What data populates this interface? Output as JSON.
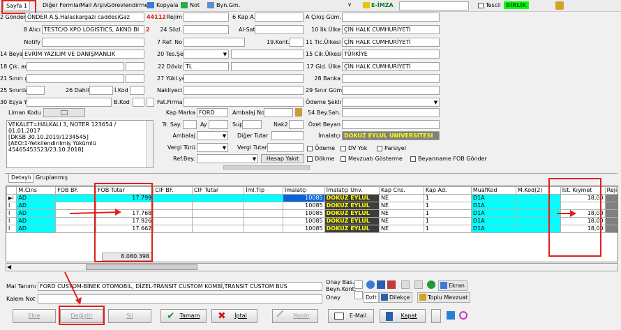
{
  "toolbar": {
    "sayfa": "Sayfa 1",
    "diger": "Diğer Formlar",
    "mail": "Mail Arşiv",
    "gorev": "Görevlendirme",
    "kopyala": "Kopyala",
    "not": "Not",
    "byn": "Byn.Gm.",
    "eimza": "E-İMZA",
    "tescil": "Tescil",
    "birlik": "BİRLİK"
  },
  "left": {
    "gonderen_lbl": "2 Gönderen",
    "gonderen_val": "ÖNDER A.Ş.Halaskargazi caddesiGaz",
    "gonderen_code": "44112",
    "alici_lbl": "8 Alıcı",
    "alici_val": "TESTC/O XPO LOGISTICS, AKNO BI",
    "alici_code": "2",
    "notify_lbl": "Notify",
    "beyan_lbl": "14 Beyan S.",
    "beyan_val": "EVRİM YAZILIM VE DANIŞMANLIK",
    "cik_lbl": "18 Çık. araç",
    "giris_lbl": "21 Sınırı geç.",
    "sinir_lbl": "25 Sınırdaki",
    "dahili_lbl": "26 Dahili",
    "ikod_lbl": "İ.Kod",
    "esya_lbl": "30 Eşya Yeri",
    "bkod_lbl": "B.Kod",
    "liman_lbl": "Liman Kodu",
    "memo": "VEKALET=HALKALI 3, NOTER 123654 /\n01.01.2017\n[DKSB 30.10.2019/1234545]\n[AEO:1-Yetkilendirilmiş Yükümlü\n45465453523/23.10.2018]"
  },
  "mid": {
    "rejim_lbl": "Rejim",
    "kapa_lbl": "6 Kap A.",
    "sozl_lbl": "24 Sözl.",
    "alsat_lbl": "Al-Sat",
    "refno_lbl": "7 Ref. No",
    "kont_lbl": "19.Kont.",
    "tes_lbl": "20 Tes.Şekli",
    "doviz_lbl": "22 Döviz",
    "doviz_val": "TL",
    "yuk_lbl": "27 Yükl.yeri",
    "nak_lbl": "Nakliyeci",
    "fat_lbl": "Fat.Firma",
    "marka_lbl": "Kap Marka",
    "marka_val": "FORD",
    "ambno_lbl": "Ambalaj No.",
    "tr_lbl": "Tr. Say.",
    "ay_lbl": "Ay",
    "sup_lbl": "Sup",
    "nak2_lbl": "Nak2",
    "amb_lbl": "Ambalaj",
    "diger_lbl": "Diğer Tutar",
    "vergi_lbl": "Vergi Türü",
    "vergit_lbl": "Vergi Tutar",
    "ref_lbl": "Ref.Bey.",
    "hesap": "Hesap Yakıt"
  },
  "right": {
    "cikis_lbl": "A Çıkış Güm.",
    "ilk_lbl": "10 İlk Ülke",
    "ilk_val": "ÇİN HALK CUMHURİYETİ",
    "tic_lbl": "11 Tic.Ülkesi",
    "tic_val": "ÇİN HALK CUMHURİYETİ",
    "cikulke_lbl": "15 Cik.Ülkesi",
    "cikulke_val": "TÜRKİYE",
    "gid_lbl": "17 Gid. Ülke",
    "gid_val": "ÇİN HALK CUMHURİYETİ",
    "banka_lbl": "28 Banka",
    "sinirgum_lbl": "29 Sınır Güm.",
    "odeme_lbl": "Ödeme Şekli",
    "beysah_lbl": "54 Bey.Sah.",
    "ozet_lbl": "Özet Beyan",
    "imal_lbl": "İmalatçı",
    "imal_val": "DOKUZ EYLUL UNIVERSITESI"
  },
  "checks": {
    "odeme": "Ödeme",
    "dv": "DV Yok",
    "parsiyel": "Parsiyel",
    "fob": "Beyanname FOB Gönder",
    "dokme": "Dökme",
    "mevzuat": "Mevzuatı Gösterme"
  },
  "tabs": [
    "Detaylı",
    "Gruplanmış"
  ],
  "grid": {
    "headers": [
      "M.Cins",
      "FOB BF.",
      "FOB Tutar",
      "CIF BF.",
      "CIF Tutar",
      "İml.Tip",
      "İmalatçı",
      "İmalatçı Unv.",
      "Kap Cns.",
      "Kap Ad.",
      "MuafKod",
      "M.Kod(2)",
      "İst. Kıymet",
      "Rejim"
    ],
    "rows": [
      {
        "cins": "AD",
        "fob": "17.799",
        "iml": "10085",
        "unv": "DOKUZ EYLUL",
        "kap": "NE",
        "ad": "1",
        "muaf": "D1A",
        "ist": "18,00"
      },
      {
        "cins": "AD",
        "fob": "",
        "iml": "10085",
        "unv": "DOKUZ EYLUL",
        "kap": "NE",
        "ad": "1",
        "muaf": "D1A",
        "ist": ""
      },
      {
        "cins": "AD",
        "fob": "17.768",
        "iml": "10085",
        "unv": "DOKUZ EYLUL",
        "kap": "NE",
        "ad": "1",
        "muaf": "D1A",
        "ist": "18,00"
      },
      {
        "cins": "AD",
        "fob": "17.926",
        "iml": "10085",
        "unv": "DOKUZ EYLUL",
        "kap": "NE",
        "ad": "1",
        "muaf": "D1A",
        "ist": "18,00"
      },
      {
        "cins": "AD",
        "fob": "17.662",
        "iml": "10085",
        "unv": "DOKUZ EYLUL",
        "kap": "NE",
        "ad": "1",
        "muaf": "D1A",
        "ist": "18,00"
      }
    ],
    "total": "8.080.398"
  },
  "bottom": {
    "mal_lbl": "Mal Tanımı",
    "mal_val": "FORD CUSTOM-BİNEK OTOMOBİL, DİZEL-TRANSIT CUSTOM KOMBİ,TRANSIT CUSTOM BUS",
    "kalem_lbl": "Kalem Not",
    "onay_bas": "Onay Bas.",
    "beyn_kont": "Beyn.Kont.",
    "onay": "Onay",
    "dzlt": "Dzlt",
    "dilekce": "Dilekçe",
    "ekran": "Ekran",
    "toplu": "Toplu Mevzuat"
  },
  "buttons": {
    "ekle": "Ekle",
    "degistir": "Değiştir",
    "sil": "Sil",
    "tamam": "Tamam",
    "iptal": "İptal",
    "yazdir": "Yazdır",
    "email": "E-Mail",
    "kapat": "Kapat"
  }
}
